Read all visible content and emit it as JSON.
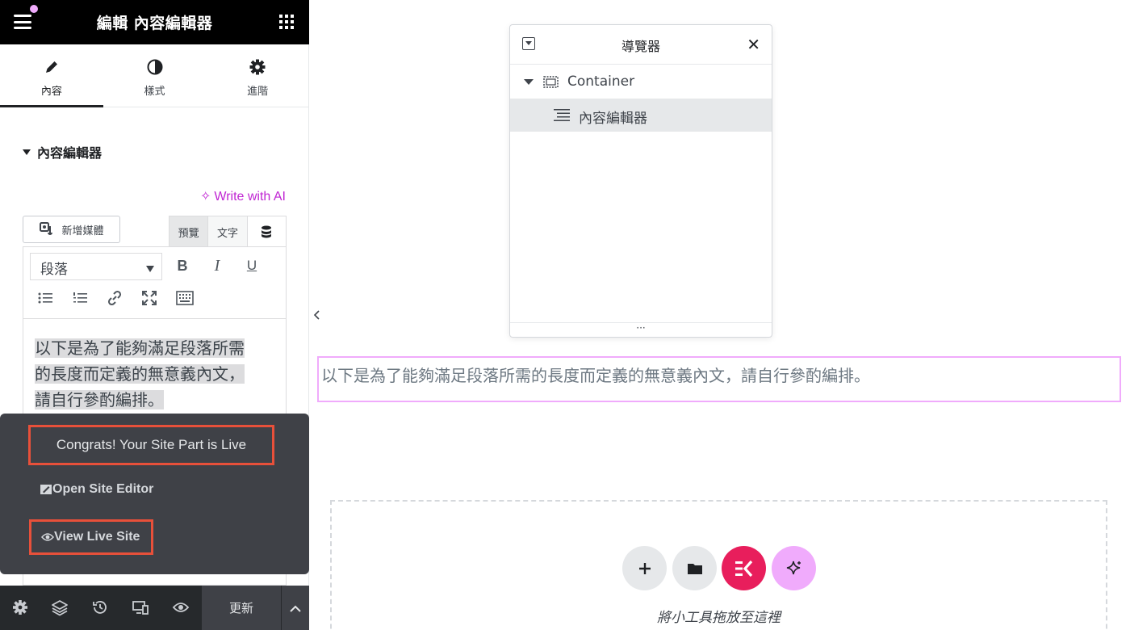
{
  "app": {
    "title": "編輯 內容編輯器"
  },
  "tabs": [
    {
      "label": "內容",
      "icon": "pencil-icon"
    },
    {
      "label": "樣式",
      "icon": "half-circle-icon"
    },
    {
      "label": "進階",
      "icon": "gear-icon"
    }
  ],
  "section": {
    "title": "內容編輯器"
  },
  "editor": {
    "write_ai_label": "Write with AI",
    "add_media_label": "新增媒體",
    "mode_tabs": [
      "預覽",
      "文字"
    ],
    "format_value": "段落",
    "content_lines": [
      "以下是為了能夠滿足段落所需",
      "的長度而定義的無意義內文，",
      "請自行參酌編排。"
    ]
  },
  "popup": {
    "congrats_label": "Congrats! Your Site Part is Live",
    "open_site_editor_label": "Open Site Editor",
    "view_live_site_label": "View Live Site"
  },
  "footer": {
    "update_label": "更新"
  },
  "navigator": {
    "title": "導覽器",
    "items": [
      {
        "label": "Container"
      },
      {
        "label": "內容編輯器"
      }
    ],
    "footer_label": "···"
  },
  "canvas": {
    "paragraph": "以下是為了能夠滿足段落所需的長度而定義的無意義內文，請自行參酌編排。",
    "drop_text": "將小工具拖放至這裡"
  },
  "colors": {
    "accent_pink": "#f0abfc",
    "ai_purple": "#c026d3",
    "elementor_red": "#e81e5c",
    "highlight_border": "#e8503a",
    "dark_header": "#000000",
    "footer_dark": "#26292c"
  }
}
